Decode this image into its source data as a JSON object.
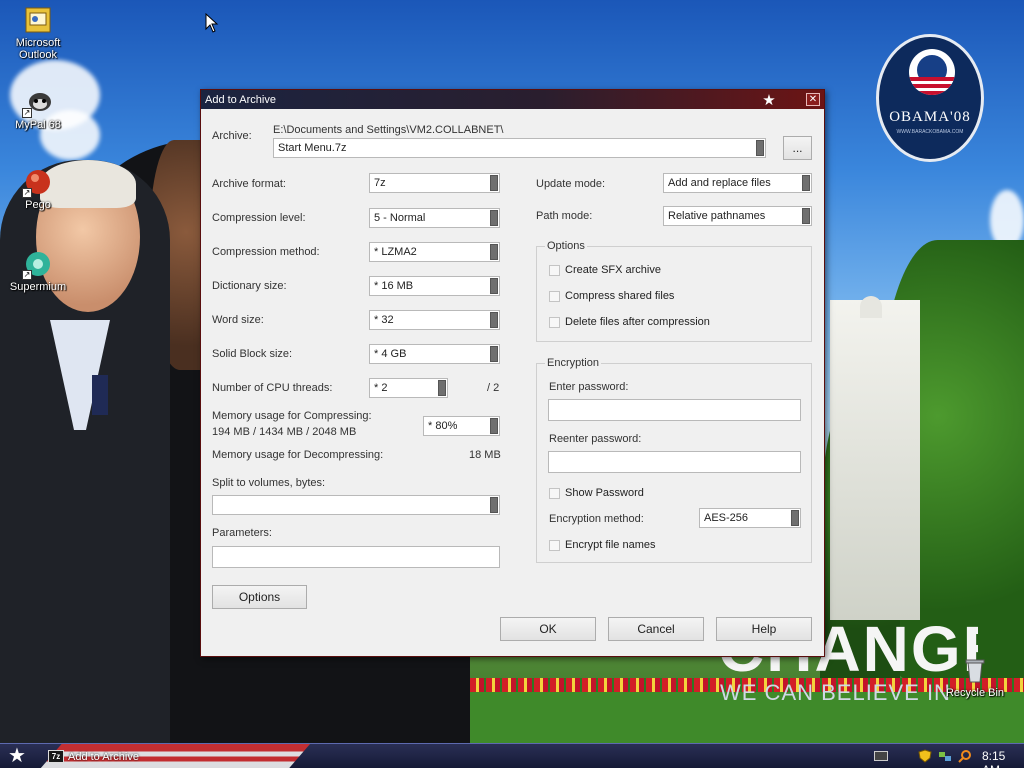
{
  "desktop": {
    "icons": [
      {
        "label": "Microsoft Outlook"
      },
      {
        "label": "MyPal 68"
      },
      {
        "label": "Pego"
      },
      {
        "label": "Supermium"
      }
    ],
    "recycle_bin": "Recycle Bin",
    "wallpaper": {
      "badge_text": "OBAMA'08",
      "badge_sub": "WWW.BARACKOBAMA.COM",
      "change": "CHANGE",
      "believe": "WE CAN BELIEVE IN"
    }
  },
  "dialog": {
    "title": "Add to Archive",
    "archive": {
      "label": "Archive:",
      "path": "E:\\Documents and Settings\\VM2.COLLABNET\\",
      "name": "Start Menu.7z",
      "browse": "..."
    },
    "left": {
      "archive_format": {
        "label": "Archive format:",
        "value": "7z"
      },
      "compression_level": {
        "label": "Compression level:",
        "value": "5 - Normal"
      },
      "compression_method": {
        "label": "Compression method:",
        "value": "* LZMA2"
      },
      "dictionary_size": {
        "label": "Dictionary size:",
        "value": "* 16 MB"
      },
      "word_size": {
        "label": "Word size:",
        "value": "* 32"
      },
      "solid_block": {
        "label": "Solid Block size:",
        "value": "* 4 GB"
      },
      "cpu_threads": {
        "label": "Number of CPU threads:",
        "value": "* 2",
        "max": "/ 2"
      },
      "mem_compress": {
        "label": "Memory usage for Compressing:",
        "detail": "194 MB / 1434 MB / 2048 MB",
        "value": "* 80%"
      },
      "mem_decompress": {
        "label": "Memory usage for Decompressing:",
        "value": "18 MB"
      },
      "split": {
        "label": "Split to volumes, bytes:",
        "value": ""
      },
      "parameters": {
        "label": "Parameters:",
        "value": ""
      },
      "options_button": "Options"
    },
    "right": {
      "update_mode": {
        "label": "Update mode:",
        "value": "Add and replace files"
      },
      "path_mode": {
        "label": "Path mode:",
        "value": "Relative pathnames"
      },
      "options_group": {
        "title": "Options",
        "items": [
          "Create SFX archive",
          "Compress shared files",
          "Delete files after compression"
        ]
      },
      "encryption": {
        "title": "Encryption",
        "enter_password": "Enter password:",
        "reenter_password": "Reenter password:",
        "show_password": "Show Password",
        "method_label": "Encryption method:",
        "method_value": "AES-256",
        "encrypt_names": "Encrypt file names"
      }
    },
    "buttons": {
      "ok": "OK",
      "cancel": "Cancel",
      "help": "Help"
    }
  },
  "taskbar": {
    "task_label": "Add to Archive",
    "task_app_icon": "7z",
    "clock": "8:15 AM"
  }
}
